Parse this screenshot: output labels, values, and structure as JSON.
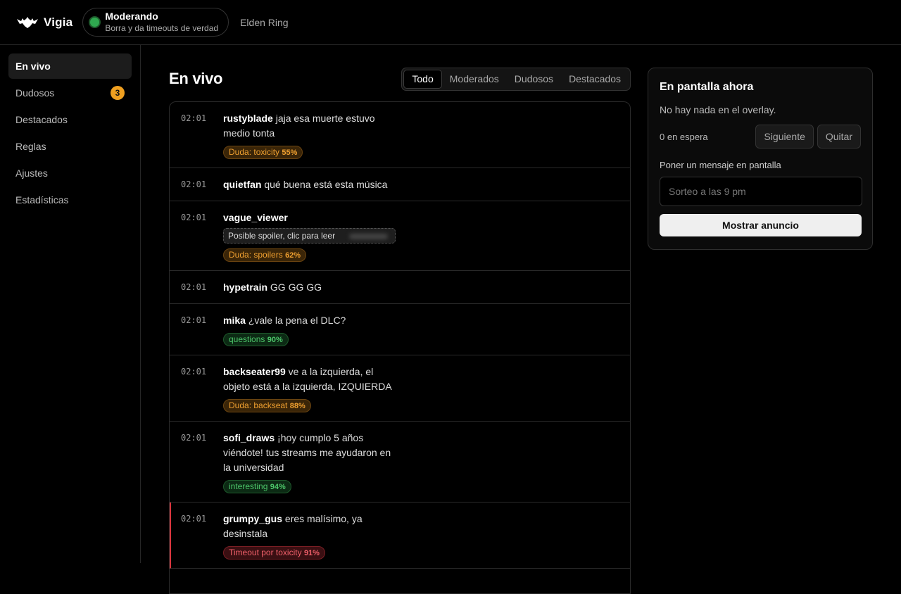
{
  "app": {
    "name": "Vigia"
  },
  "status": {
    "title": "Moderando",
    "subtitle": "Borra y da timeouts de verdad",
    "game": "Elden Ring"
  },
  "sidebar": {
    "items": [
      {
        "label": "En vivo",
        "active": true
      },
      {
        "label": "Dudosos",
        "badge": "3"
      },
      {
        "label": "Destacados"
      },
      {
        "label": "Reglas"
      },
      {
        "label": "Ajustes"
      },
      {
        "label": "Estadísticas"
      }
    ]
  },
  "main": {
    "title": "En vivo",
    "tabs": [
      {
        "label": "Todo",
        "active": true
      },
      {
        "label": "Moderados"
      },
      {
        "label": "Dudosos"
      },
      {
        "label": "Destacados"
      }
    ],
    "messages": [
      {
        "time": "02:01",
        "user": "rustyblade",
        "text": "jaja esa muerte estuvo medio tonta",
        "tag": {
          "label": "Duda: toxicity",
          "score": "55%",
          "kind": "warn"
        }
      },
      {
        "time": "02:01",
        "user": "quietfan",
        "text": "qué buena está esta música"
      },
      {
        "time": "02:01",
        "user": "vague_viewer",
        "spoiler": "Posible spoiler, clic para leer",
        "tag": {
          "label": "Duda: spoilers",
          "score": "62%",
          "kind": "warn"
        }
      },
      {
        "time": "02:01",
        "user": "hypetrain",
        "text": "GG GG GG"
      },
      {
        "time": "02:01",
        "user": "mika",
        "text": "¿vale la pena el DLC?",
        "tag": {
          "label": "questions",
          "score": "90%",
          "kind": "good"
        }
      },
      {
        "time": "02:01",
        "user": "backseater99",
        "text": "ve a la izquierda, el objeto está a la izquierda, IZQUIERDA",
        "tag": {
          "label": "Duda: backseat",
          "score": "88%",
          "kind": "warn"
        }
      },
      {
        "time": "02:01",
        "user": "sofi_draws",
        "text": "¡hoy cumplo 5 años viéndote! tus streams me ayudaron en la universidad",
        "tag": {
          "label": "interesting",
          "score": "94%",
          "kind": "good"
        }
      },
      {
        "time": "02:01",
        "user": "grumpy_gus",
        "text": "eres malísimo, ya desinstala",
        "tag": {
          "label": "Timeout por toxicity",
          "score": "91%",
          "kind": "bad"
        },
        "flagged": true
      }
    ]
  },
  "panel": {
    "title": "En pantalla ahora",
    "empty": "No hay nada en el overlay.",
    "queue": "0 en espera",
    "next_label": "Siguiente",
    "remove_label": "Quitar",
    "input_label": "Poner un mensaje en pantalla",
    "input_placeholder": "Sorteo a las 9 pm",
    "submit_label": "Mostrar anuncio"
  }
}
